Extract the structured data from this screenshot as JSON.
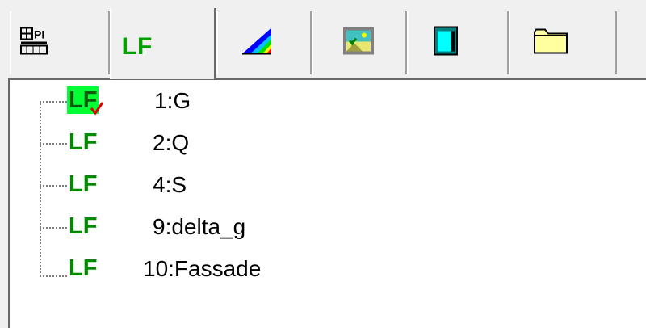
{
  "tabs": [
    {
      "name": "pi-tab",
      "icon": "pi-grid-icon",
      "label": ""
    },
    {
      "name": "lf-tab",
      "icon": "lf-icon",
      "label": "LF",
      "active": true
    },
    {
      "name": "color-triangle-tab",
      "icon": "color-triangle-icon",
      "label": ""
    },
    {
      "name": "landscape-tab",
      "icon": "landscape-picture-icon",
      "label": ""
    },
    {
      "name": "window-tab",
      "icon": "window-panel-icon",
      "label": ""
    },
    {
      "name": "folder-tab",
      "icon": "folder-icon",
      "label": ""
    }
  ],
  "tree": {
    "items": [
      {
        "icon_text": "LF",
        "label": "1:G",
        "selected": true,
        "checked": true
      },
      {
        "icon_text": "LF",
        "label": "2:Q"
      },
      {
        "icon_text": "LF",
        "label": "4:S"
      },
      {
        "icon_text": "LF",
        "label": "9:delta_g"
      },
      {
        "icon_text": "LF",
        "label": "10:Fassade"
      }
    ]
  },
  "colors": {
    "lf_green": "#008a00",
    "selection_highlight": "#00ff33",
    "check_red": "#e00000"
  }
}
